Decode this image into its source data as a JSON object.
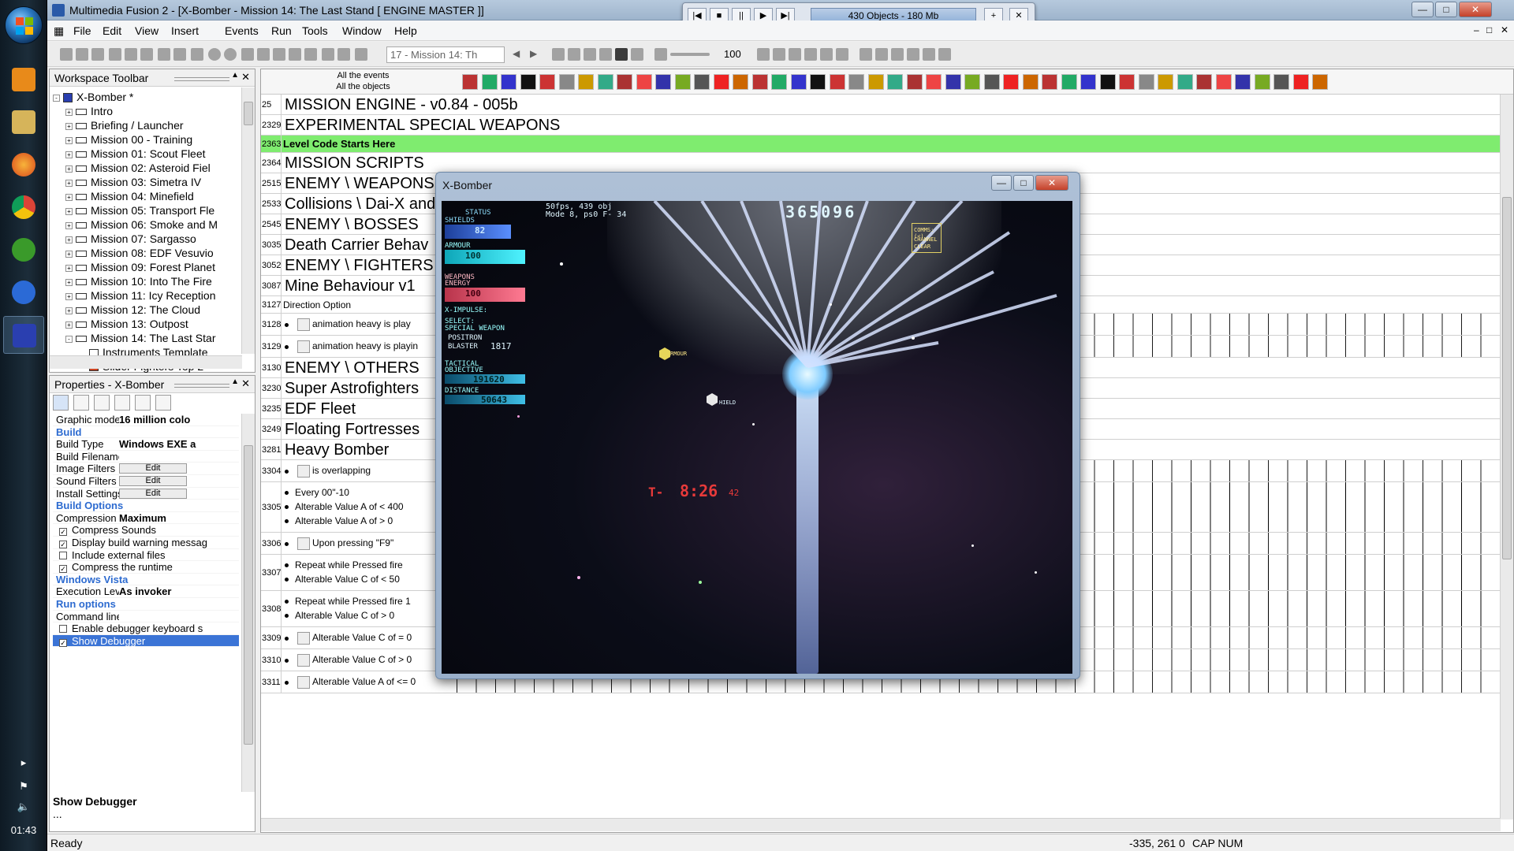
{
  "taskbar": {
    "apps": [
      {
        "name": "media-player",
        "color": "#e88a1a"
      },
      {
        "name": "explorer",
        "color": "#d6b45a"
      },
      {
        "name": "firefox",
        "color": "#e0611c"
      },
      {
        "name": "chrome",
        "color": "#e2c21e"
      },
      {
        "name": "utorrent",
        "color": "#3a9a2a"
      },
      {
        "name": "fusion2",
        "color": "#2b6ad6"
      },
      {
        "name": "xbomber",
        "color": "#2a3fb0"
      }
    ],
    "clock": "01:43"
  },
  "window": {
    "title": "Multimedia Fusion 2 - [X-Bomber - Mission 14: The Last Stand [ ENGINE MASTER ]]"
  },
  "run_toolbar": {
    "info": "430 Objects - 180 Mb"
  },
  "menu": [
    "File",
    "Edit",
    "View",
    "Insert",
    "Events",
    "Run",
    "Tools",
    "Window",
    "Help"
  ],
  "toolbar": {
    "frame": "17 - Mission 14: Th",
    "zoom": "100"
  },
  "workspace": {
    "title": "Workspace Toolbar",
    "root": "X-Bomber *",
    "items": [
      "Intro",
      "Briefing / Launcher",
      "Mission 00 - Training",
      "Mission 01: Scout Fleet",
      "Mission 02: Asteroid Fiel",
      "Mission 03: Simetra IV",
      "Mission 04: Minefield",
      "Mission 05: Transport Fle",
      "Mission 06: Smoke and M",
      "Mission 07: Sargasso",
      "Mission 08: EDF Vesuvio",
      "Mission 09: Forest Planet",
      "Mission 10: Into The Fire",
      "Mission 11: Icy Reception",
      "Mission 12: The Cloud",
      "Mission 13: Outpost",
      "Mission 14: The Last Star"
    ],
    "sub_items": [
      "Instruments Template",
      "Slider Fighters Top 2"
    ]
  },
  "properties": {
    "title": "Properties - X-Bomber",
    "rows": [
      {
        "k": "Graphic mode",
        "v": "16 million colo"
      },
      {
        "section": "Build"
      },
      {
        "k": "Build Type",
        "v": "Windows EXE a"
      },
      {
        "k": "Build Filename",
        "v": ""
      },
      {
        "k": "Image Filters",
        "btn": "Edit"
      },
      {
        "k": "Sound Filters",
        "btn": "Edit"
      },
      {
        "k": "Install Settings",
        "btn": "Edit"
      },
      {
        "section": "Build Options"
      },
      {
        "k": "Compression L",
        "v": "Maximum"
      },
      {
        "check": "Compress Sounds",
        "on": true
      },
      {
        "check": "Display build warning messag",
        "on": true
      },
      {
        "check": "Include external files",
        "on": false
      },
      {
        "check": "Compress the runtime",
        "on": true
      },
      {
        "section": "Windows Vista"
      },
      {
        "k": "Execution Leve",
        "v": "As invoker"
      },
      {
        "section": "Run options"
      },
      {
        "k": "Command line",
        "v": ""
      },
      {
        "check": "Enable debugger keyboard s",
        "on": false
      },
      {
        "check": "Show Debugger",
        "on": true,
        "selected": true
      }
    ],
    "desc_title": "Show Debugger",
    "desc_text": "..."
  },
  "events": {
    "header_top": "All the events",
    "header_bottom": "All the objects",
    "lines": [
      {
        "n": "25",
        "type": "group",
        "text": "MISSION ENGINE - v0.84 - 005b"
      },
      {
        "n": "2329",
        "type": "group",
        "text": "EXPERIMENTAL SPECIAL WEAPONS"
      },
      {
        "n": "2363",
        "type": "comment",
        "text": "Level Code Starts Here"
      },
      {
        "n": "2364",
        "type": "group",
        "text": "MISSION SCRIPTS"
      },
      {
        "n": "2515",
        "type": "group",
        "text": "ENEMY \\ WEAPONS"
      },
      {
        "n": "2533",
        "type": "group",
        "text": "Collisions \\ Dai-X and"
      },
      {
        "n": "2545",
        "type": "group",
        "text": "ENEMY \\ BOSSES"
      },
      {
        "n": "3035",
        "type": "group",
        "text": "Death Carrier Behav"
      },
      {
        "n": "3052",
        "type": "group",
        "text": "ENEMY \\ FIGHTERS"
      },
      {
        "n": "3087",
        "type": "group",
        "text": "Mine Behaviour v1"
      },
      {
        "n": "3127",
        "type": "plain",
        "text": "Direction Option"
      },
      {
        "n": "3128",
        "type": "cond",
        "text": "animation heavy is play"
      },
      {
        "n": "3129",
        "type": "cond",
        "text": "animation heavy is playin"
      },
      {
        "n": "3130",
        "type": "group",
        "text": "ENEMY \\ OTHERS"
      },
      {
        "n": "3230",
        "type": "group",
        "text": "Super Astrofighters"
      },
      {
        "n": "3235",
        "type": "group",
        "text": "EDF Fleet"
      },
      {
        "n": "3249",
        "type": "group",
        "text": "Floating Fortresses"
      },
      {
        "n": "3281",
        "type": "group",
        "text": "Heavy Bomber"
      },
      {
        "n": "3304",
        "type": "cond",
        "text": "is overlapping"
      },
      {
        "n": "3305",
        "type": "multi",
        "conds": [
          "Every 00\"-10",
          "Alterable Value A of  < 400",
          "Alterable Value A of  > 0"
        ]
      },
      {
        "n": "3306",
        "type": "cond",
        "text": "Upon pressing \"F9\""
      },
      {
        "n": "3307",
        "type": "multi",
        "conds": [
          "Repeat while  Pressed fire",
          "Alterable Value C of  < 50"
        ]
      },
      {
        "n": "3308",
        "type": "multi",
        "conds": [
          "Repeat while  Pressed fire 1",
          "Alterable Value C of  > 0"
        ]
      },
      {
        "n": "3309",
        "type": "cond",
        "text": "Alterable Value C of  = 0"
      },
      {
        "n": "3310",
        "type": "cond",
        "text": "Alterable Value C of  > 0"
      },
      {
        "n": "3311",
        "type": "cond",
        "text": "Alterable Value A of  <= 0"
      }
    ],
    "object_icon_count": 0
  },
  "game": {
    "title": "X-Bomber",
    "score": "365096",
    "fps": "50fps, 439 obj",
    "mode": "Mode 8, ps0 F-   34",
    "status_label": "STATUS",
    "shields_label": "SHIELDS",
    "shields_value": "82",
    "armour_label": "ARMOUR",
    "armour_value": "100",
    "weapons_label": "WEAPONS",
    "energy_label": "ENERGY",
    "energy_value": "100",
    "ximpulse_label": "X-IMPULSE:",
    "select_label": "SELECT:",
    "special_label": "SPECIAL WEAPON",
    "positron": "POSITRON",
    "blaster": "BLASTER",
    "blaster_value": "1817",
    "tactical_label": "TACTICAL",
    "objective_label": "OBJECTIVE",
    "objective_value": "191620",
    "distance_label": "DISTANCE",
    "distance_value": "50643",
    "comms_1": "COMMS:(<)",
    "comms_2": "CHANNEL",
    "comms_3": "CLEAR",
    "pickup_armour": "RMOUR",
    "pickup_shield": "HIELD",
    "timer_prefix": "T-",
    "timer": "8:26",
    "timer_sub": "42"
  },
  "status": {
    "left": "Ready",
    "coords": "-335, 261   0",
    "caps": "CAP NUM"
  }
}
